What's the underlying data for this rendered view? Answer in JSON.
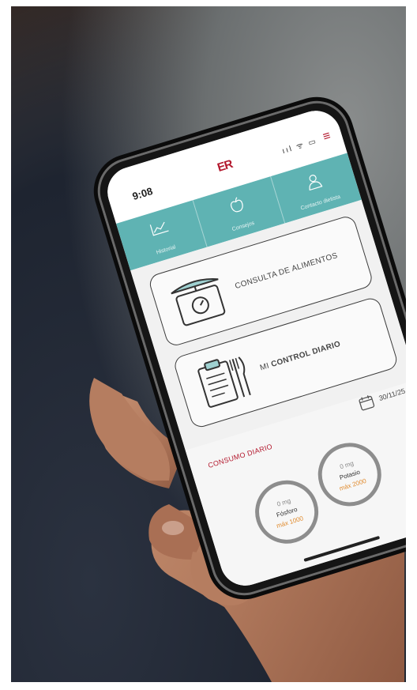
{
  "status": {
    "time": "9:08",
    "icons": "ııl ᯤ ▭"
  },
  "logo": {
    "mark": "ER",
    "text": ""
  },
  "menu_icon": "hamburger-icon",
  "tabs": [
    {
      "label": "Historial",
      "icon": "chart-icon",
      "glyph": "⌁"
    },
    {
      "label": "Consejos",
      "icon": "apple-icon",
      "glyph": ""
    },
    {
      "label": "Contacto dietista",
      "icon": "person-icon",
      "glyph": "⚇"
    }
  ],
  "cards": [
    {
      "label": "CONSULTA DE ALIMENTOS",
      "icon": "scale-icon"
    },
    {
      "label_prefix": "MI",
      "label_main": "CONTROL DIARIO",
      "icon": "clipboard-cutlery-icon"
    }
  ],
  "consumo": {
    "title": "CONSUMO DIARIO",
    "date": "30/11/25",
    "gauges": [
      {
        "value": "0 mg",
        "name": "Fósforo",
        "max": "máx 1000"
      },
      {
        "value": "0 mg",
        "name": "Potasio",
        "max": "máx 2000"
      }
    ],
    "arrow": "›",
    "corner_label": ""
  },
  "colors": {
    "teal": "#5fb3b3",
    "brand_red": "#b3182d",
    "orange": "#e08a2c"
  }
}
